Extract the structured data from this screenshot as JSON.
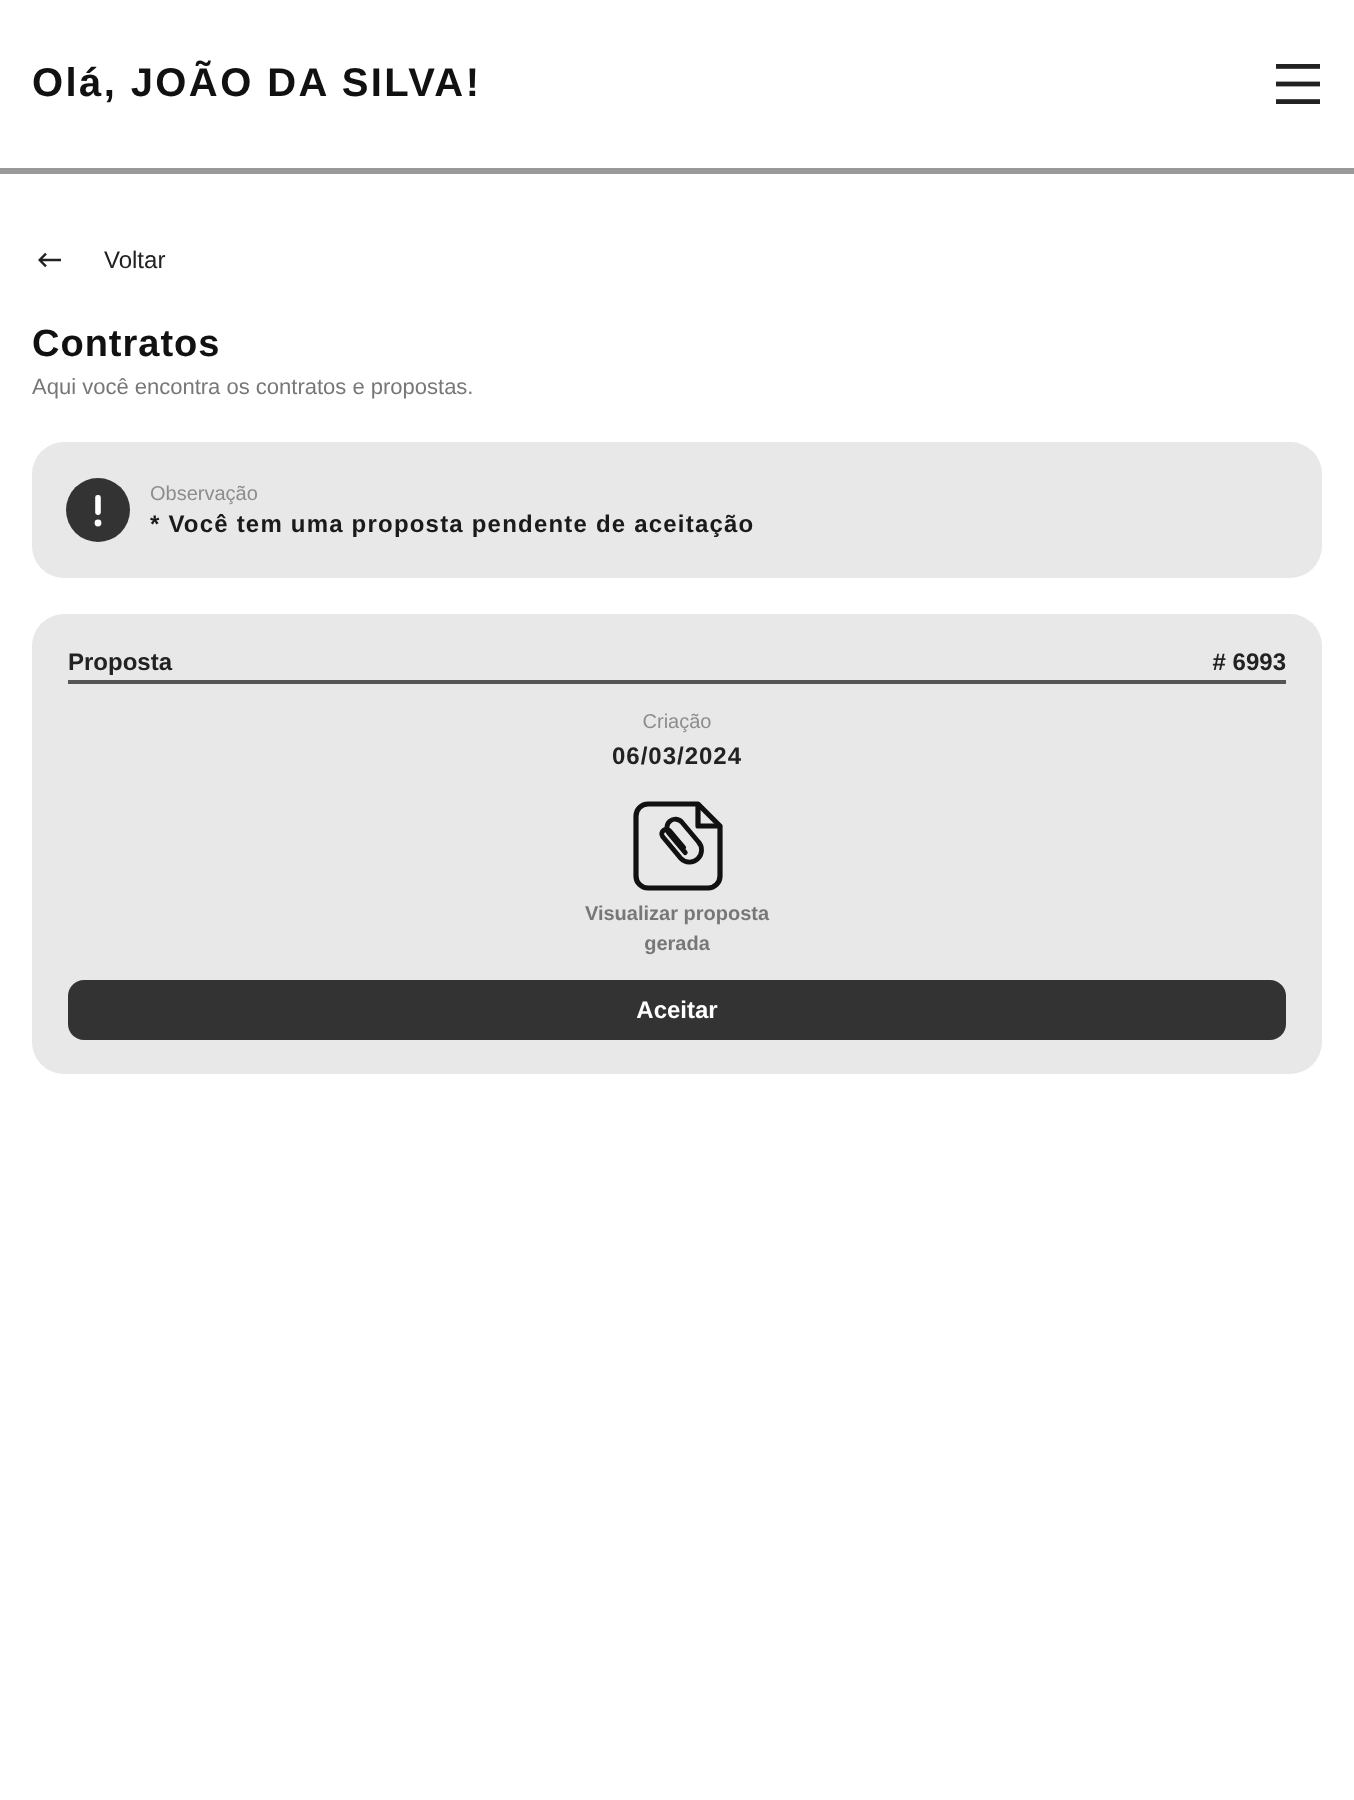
{
  "header": {
    "title": "Olá, JOÃO DA SILVA!"
  },
  "back_link": {
    "label": "Voltar"
  },
  "page": {
    "title": "Contratos",
    "subtitle": "Aqui você encontra os contratos e propostas."
  },
  "notice": {
    "label": "Observação",
    "message": "* Você tem uma proposta pendente de aceitação"
  },
  "proposal": {
    "title": "Proposta",
    "number": "# 6993",
    "date_label": "Criação",
    "date": "06/03/2024",
    "document_link": "Visualizar proposta gerada",
    "button": "Aceitar"
  }
}
